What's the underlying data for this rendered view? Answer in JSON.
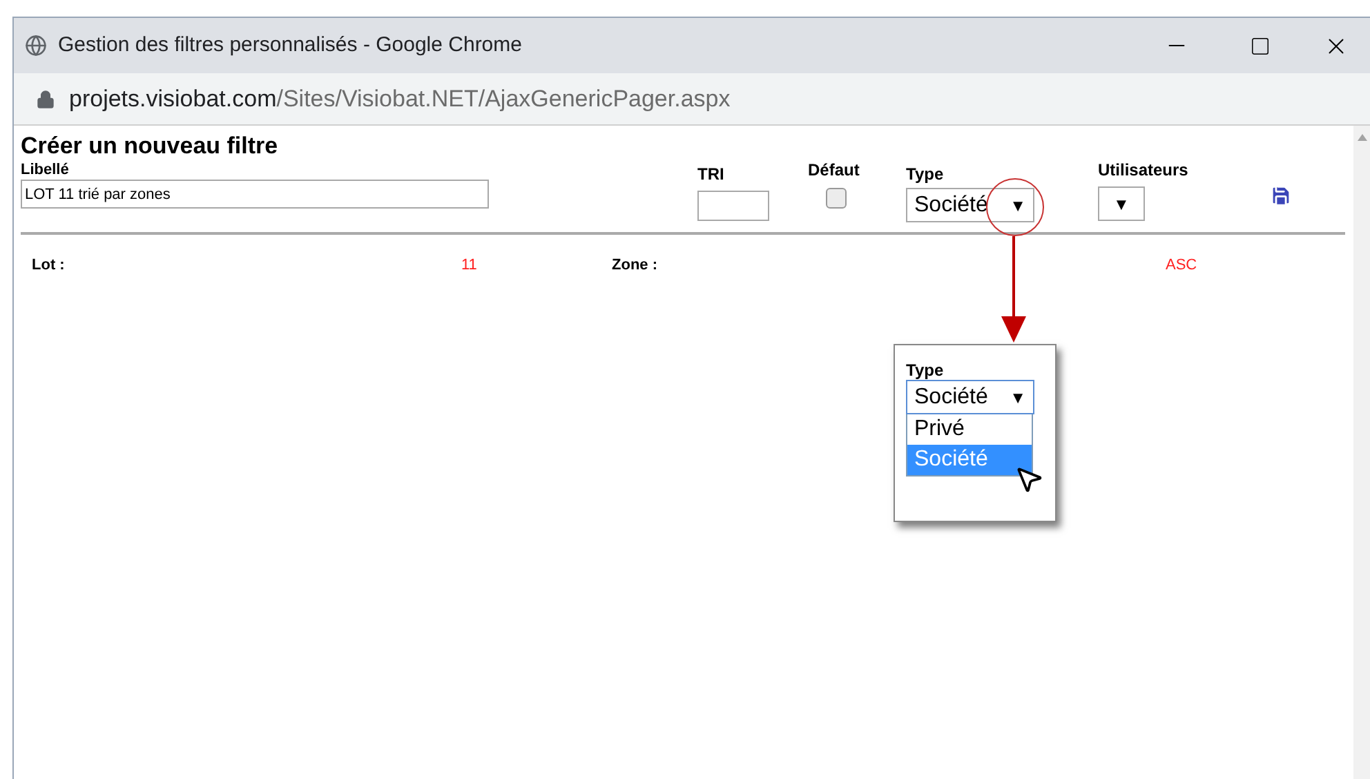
{
  "window": {
    "title": "Gestion des filtres personnalisés - Google Chrome"
  },
  "address_bar": {
    "host": "projets.visiobat.com",
    "path": "/Sites/Visiobat.NET/AjaxGenericPager.aspx"
  },
  "heading": "Créer un nouveau filtre",
  "form": {
    "libelle": {
      "label": "Libellé",
      "value": "LOT 11 trié par zones"
    },
    "tri": {
      "label": "TRI"
    },
    "defaut": {
      "label": "Défaut",
      "checked": false
    },
    "type": {
      "label": "Type",
      "value": "Société",
      "arrow": "▼"
    },
    "utilisateurs": {
      "label": "Utilisateurs",
      "arrow": "▼"
    }
  },
  "criteria_row": {
    "lot_label": "Lot :",
    "lot_value": "11",
    "zone_label": "Zone :",
    "order": "ASC"
  },
  "callout": {
    "label": "Type",
    "value": "Société",
    "arrow": "▼",
    "options": [
      {
        "label": "Privé",
        "selected": false
      },
      {
        "label": "Société",
        "selected": true
      }
    ]
  }
}
